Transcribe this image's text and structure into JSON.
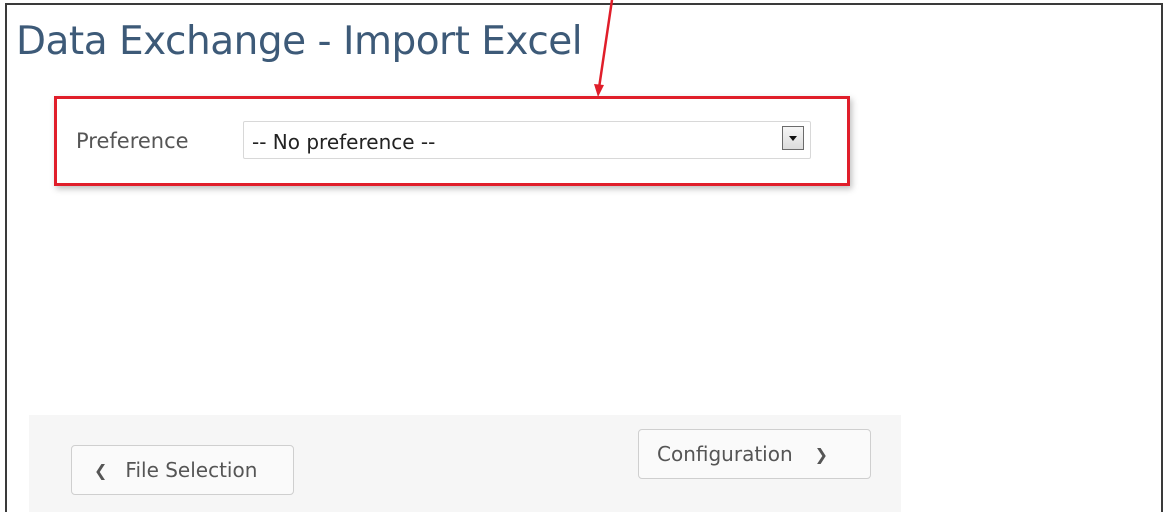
{
  "page": {
    "title": "Data Exchange - Import Excel"
  },
  "preference": {
    "label": "Preference",
    "selected": "-- No preference --"
  },
  "navigation": {
    "prev_label": "File Selection",
    "next_label": "Configuration"
  },
  "icons": {
    "prev": "chevron-left-icon",
    "next": "chevron-right-icon",
    "dropdown": "dropdown-arrow-icon"
  },
  "colors": {
    "title": "#3d5a78",
    "highlight": "#e01e2a",
    "footer_bg": "#f6f6f6"
  }
}
